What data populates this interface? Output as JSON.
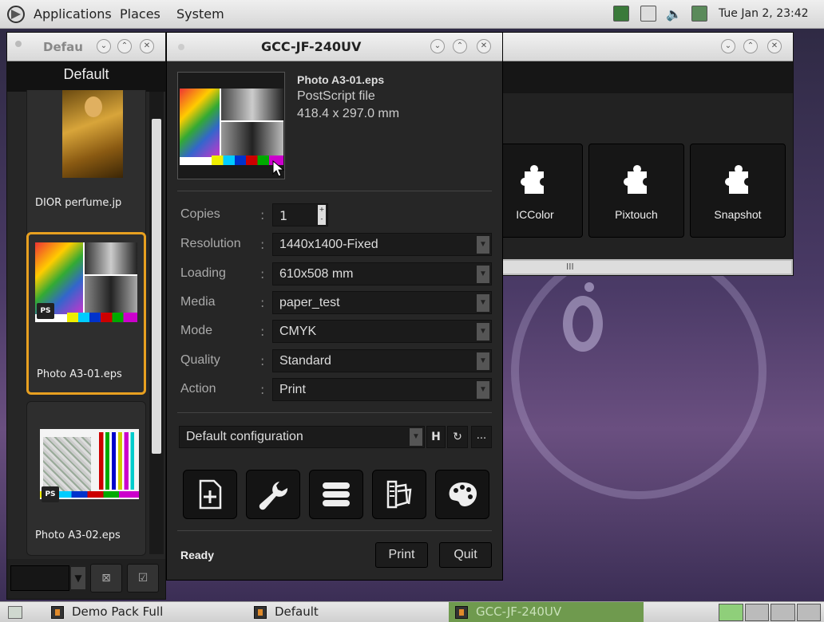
{
  "top_panel": {
    "menus": [
      "Applications",
      "Places",
      "System"
    ],
    "clock": "Tue Jan  2, 23:42"
  },
  "left_window": {
    "title": "Defau",
    "header": "Default",
    "items": [
      {
        "label": "DIOR perfume.jp"
      },
      {
        "label": "Photo A3-01.eps",
        "badge": "PS"
      },
      {
        "label": "Photo A3-02.eps",
        "badge": "PS"
      }
    ]
  },
  "plugins_window": {
    "plugins": [
      "ICColor",
      "Pixtouch",
      "Snapshot"
    ],
    "scroll_grip": "III"
  },
  "dialog": {
    "title": "GCC-JF-240UV",
    "file": {
      "name": "Photo A3-01.eps",
      "type": "PostScript file",
      "size": "418.4 x 297.0 mm"
    },
    "fields": {
      "copies": {
        "label": "Copies",
        "value": "1"
      },
      "resolution": {
        "label": "Resolution",
        "value": "1440x1400-Fixed"
      },
      "loading": {
        "label": "Loading",
        "value": "610x508 mm"
      },
      "media": {
        "label": "Media",
        "value": "paper_test"
      },
      "mode": {
        "label": "Mode",
        "value": "CMYK"
      },
      "quality": {
        "label": "Quality",
        "value": "Standard"
      },
      "action": {
        "label": "Action",
        "value": "Print"
      }
    },
    "configuration": "Default configuration",
    "more": "...",
    "status": "Ready",
    "print_label": "Print",
    "quit_label": "Quit"
  },
  "taskbar": {
    "tasks": [
      "Demo Pack Full",
      "Default",
      "GCC-JF-240UV"
    ]
  }
}
